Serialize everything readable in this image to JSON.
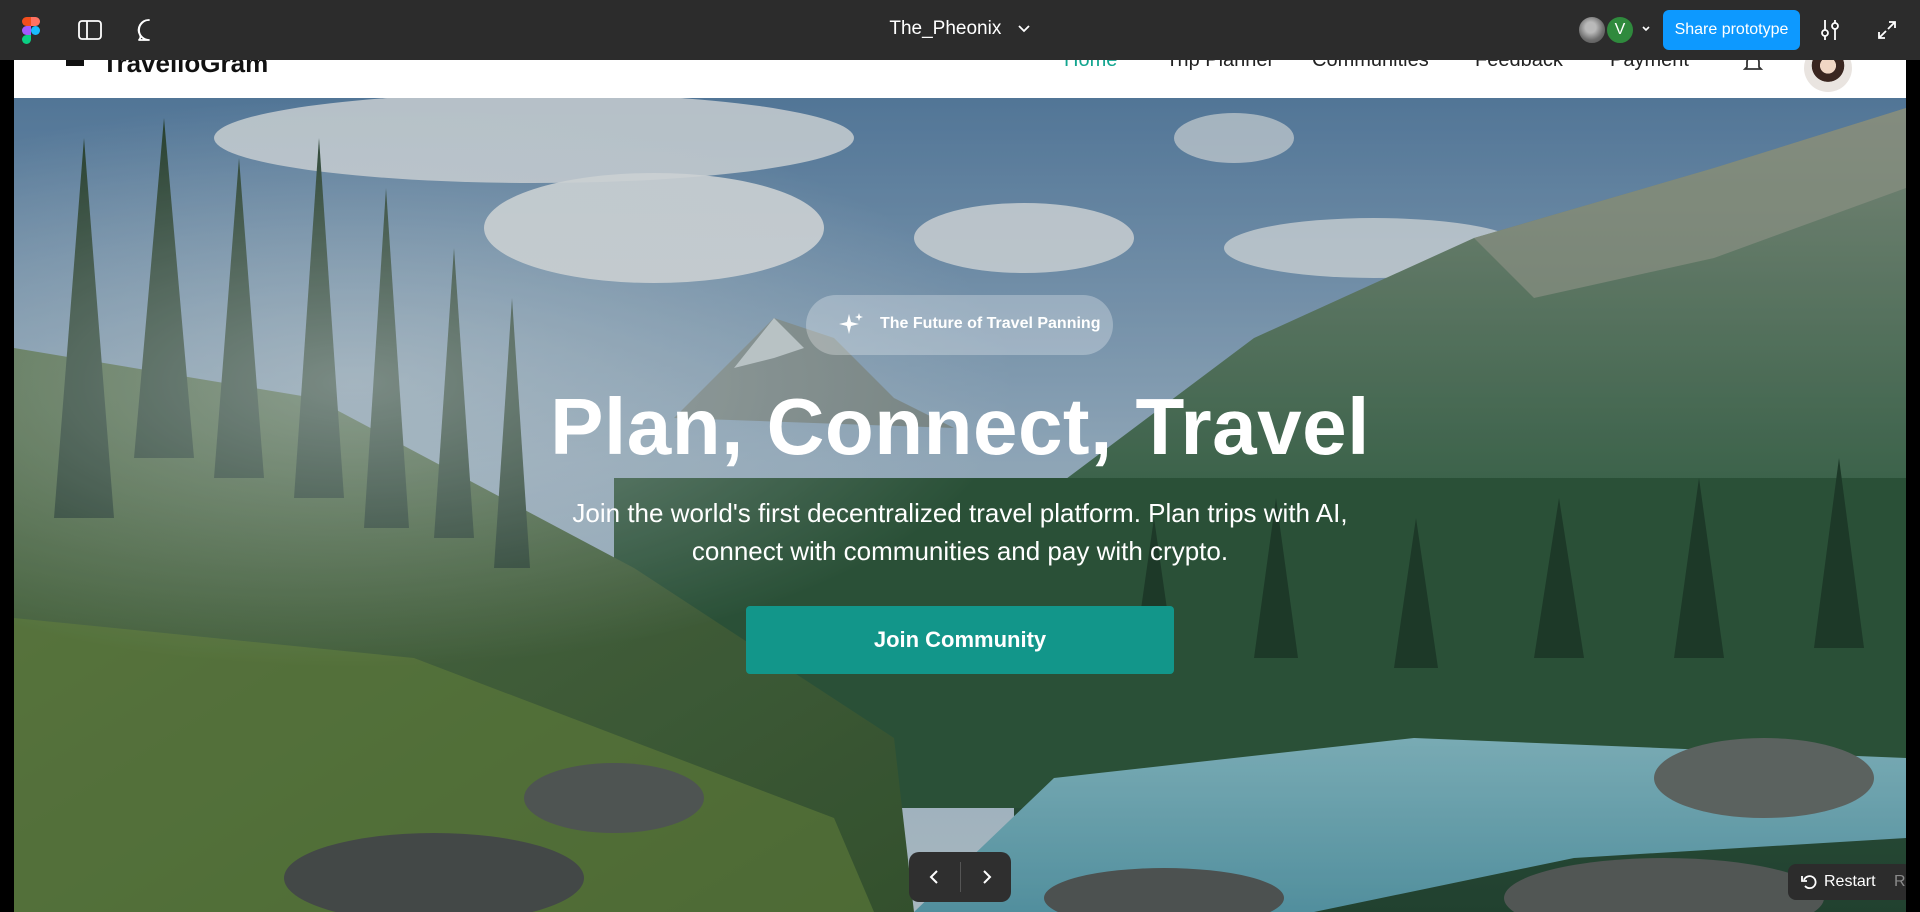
{
  "figma_bar": {
    "file_title": "The_Pheonix",
    "user_initial": "V",
    "share_label": "Share prototype",
    "icons": [
      "figma-logo",
      "sidebar-toggle-icon",
      "comment-icon",
      "chevron-down-icon",
      "settings-sliders-icon",
      "expand-icon"
    ]
  },
  "site": {
    "brand": "TravelloGram",
    "nav": [
      "Home",
      "Trip Planner",
      "Communities",
      "Feedback",
      "Payment"
    ],
    "active_nav": "Home",
    "accent_color": "#12a58f"
  },
  "hero": {
    "badge": "The Future of Travel Panning",
    "title": "Plan, Connect, Travel",
    "subtitle_line1": "Join the world's first decentralized travel platform. Plan trips with AI,",
    "subtitle_line2": "connect with communities and pay with crypto.",
    "cta": "Join Community",
    "cta_color": "#12968a"
  },
  "prototype_controls": {
    "restart_label": "Restart",
    "restart_key": "R"
  }
}
